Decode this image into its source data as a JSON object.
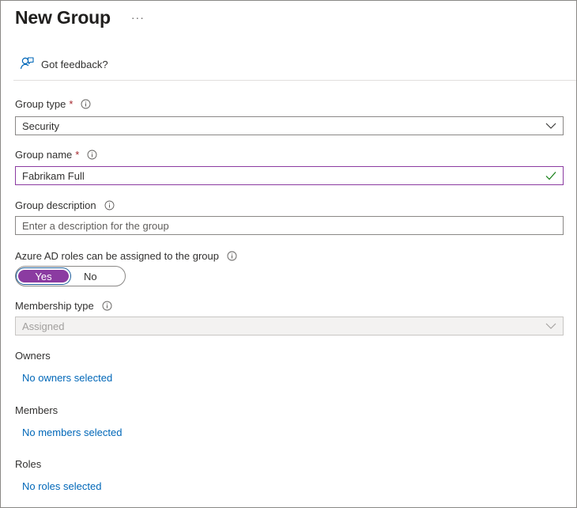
{
  "header": {
    "title": "New Group",
    "more_label": "···"
  },
  "toolbar": {
    "feedback_label": "Got feedback?"
  },
  "form": {
    "group_type": {
      "label": "Group type",
      "required_mark": "*",
      "value": "Security"
    },
    "group_name": {
      "label": "Group name",
      "required_mark": "*",
      "value": "Fabrikam Full"
    },
    "group_description": {
      "label": "Group description",
      "placeholder": "Enter a description for the group"
    },
    "azure_ad_roles": {
      "label": "Azure AD roles can be assigned to the group",
      "options": [
        "Yes",
        "No"
      ],
      "selected": "Yes"
    },
    "membership_type": {
      "label": "Membership type",
      "value": "Assigned"
    },
    "owners": {
      "label": "Owners",
      "link": "No owners selected"
    },
    "members": {
      "label": "Members",
      "link": "No members selected"
    },
    "roles": {
      "label": "Roles",
      "link": "No roles selected"
    }
  },
  "colors": {
    "accent": "#8b3ba1",
    "link": "#0067b8",
    "required": "#a4262c",
    "valid_check": "#107c10"
  },
  "icons": [
    "feedback-icon",
    "info-icon",
    "chevron-down-icon",
    "checkmark-icon"
  ]
}
